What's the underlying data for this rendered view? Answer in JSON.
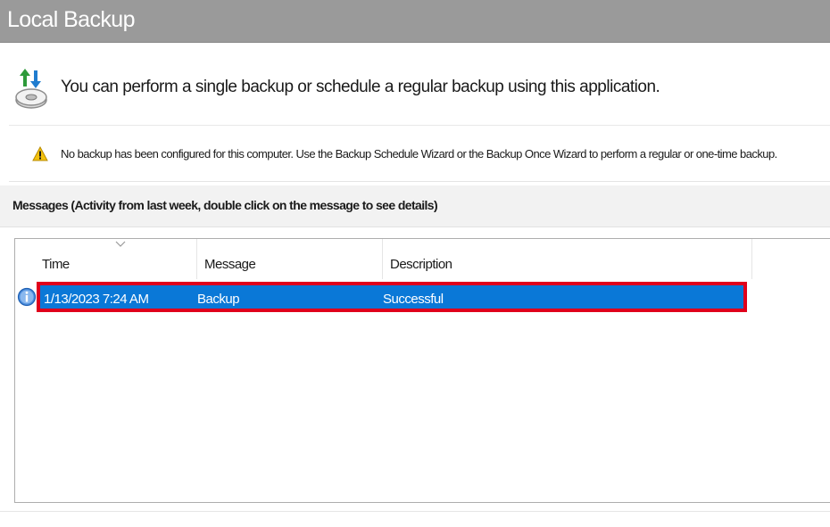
{
  "window": {
    "title": "Local Backup"
  },
  "intro": {
    "icon": "backup-drive-icon",
    "text": "You can perform a single backup or schedule a regular backup using this application."
  },
  "warning": {
    "icon": "warning-icon",
    "text": "No backup has been configured for this computer. Use the Backup Schedule Wizard or the Backup Once Wizard to perform a regular or one-time backup."
  },
  "messages": {
    "header": "Messages (Activity from last week, double click on the message to see details)",
    "columns": [
      "Time",
      "Message",
      "Description"
    ],
    "rows": [
      {
        "icon": "info-icon",
        "time": "1/13/2023 7:24 AM",
        "message": "Backup",
        "description": "Successful",
        "selected": true
      }
    ]
  },
  "colors": {
    "title_bar": "#9a9a9a",
    "selection": "#0a78d7",
    "highlight_border": "#e0001b"
  }
}
